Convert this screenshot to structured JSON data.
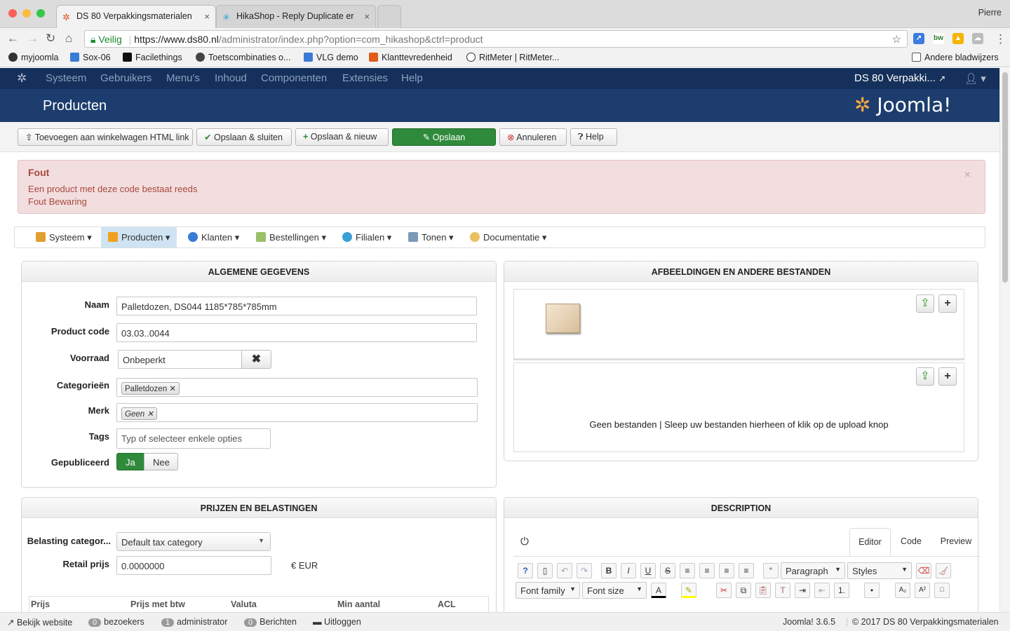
{
  "browser": {
    "tabs": [
      {
        "title": "DS 80 Verpakkingsmaterialen",
        "close": "×"
      },
      {
        "title": "HikaShop - Reply Duplicate er",
        "close": "×"
      }
    ],
    "profile": "Pierre",
    "url": {
      "secure_label": "Veilig",
      "scheme_host": "https://www.ds80.nl",
      "path": "/administrator/index.php?option=com_hikashop&ctrl=product"
    },
    "bookmarks": [
      "myjoomla",
      "Sox-06",
      "Facilethings",
      "Toetscombinaties o...",
      "VLG demo",
      "Klanttevredenheid",
      "RitMeter | RitMeter..."
    ],
    "other_bookmarks": "Andere bladwijzers"
  },
  "joomla_nav": {
    "items": [
      "Systeem",
      "Gebruikers",
      "Menu's",
      "Inhoud",
      "Componenten",
      "Extensies",
      "Help"
    ],
    "site": "DS 80 Verpakki...",
    "user_icon": "user-icon"
  },
  "header": {
    "title": "Producten",
    "brand": "Joomla!"
  },
  "toolbar": {
    "add_cart_link": "Toevoegen aan winkelwagen HTML link",
    "save_close": "Opslaan & sluiten",
    "save_new": "Opslaan & nieuw",
    "save": "Opslaan",
    "cancel": "Annuleren",
    "help": "Help"
  },
  "alert": {
    "heading": "Fout",
    "line1": "Een product met deze code bestaat reeds",
    "line2": "Fout Bewaring",
    "close": "×"
  },
  "hika_menu": [
    "Systeem",
    "Producten",
    "Klanten",
    "Bestellingen",
    "Filialen",
    "Tonen",
    "Documentatie"
  ],
  "general": {
    "title": "ALGEMENE GEGEVENS",
    "name_label": "Naam",
    "name_value": "Palletdozen, DS044 1185*785*785mm",
    "code_label": "Product code",
    "code_value": "03.03..0044",
    "stock_label": "Voorraad",
    "stock_value": "Onbeperkt",
    "cat_label": "Categorieën",
    "cat_chip": "Palletdozen",
    "brand_label": "Merk",
    "brand_chip": "Geen",
    "tags_label": "Tags",
    "tags_placeholder": "Typ of selecteer enkele opties",
    "pub_label": "Gepubliceerd",
    "pub_yes": "Ja",
    "pub_no": "Nee"
  },
  "files": {
    "title": "AFBEELDINGEN EN ANDERE BESTANDEN",
    "empty": "Geen bestanden | Sleep uw bestanden hierheen of klik op de upload knop"
  },
  "prices": {
    "title": "PRIJZEN EN BELASTINGEN",
    "tax_label": "Belasting categor...",
    "tax_value": "Default tax category",
    "retail_label": "Retail prijs",
    "retail_value": "0.0000000",
    "currency": "€ EUR",
    "columns": [
      "Prijs",
      "Prijs met btw",
      "Valuta",
      "Min aantal",
      "ACL"
    ]
  },
  "description": {
    "title": "DESCRIPTION",
    "tabs": [
      "Editor",
      "Code",
      "Preview"
    ],
    "format": "Paragraph",
    "styles": "Styles",
    "font_family": "Font family",
    "font_size": "Font size"
  },
  "status": {
    "view_site": "Bekijk website",
    "visitors_count": "0",
    "visitors": "bezoekers",
    "admin_count": "1",
    "admin": "administrator",
    "messages_count": "0",
    "messages": "Berichten",
    "logout": "Uitloggen",
    "version": "Joomla! 3.6.5",
    "copyright": "© 2017 DS 80 Verpakkingsmaterialen"
  }
}
